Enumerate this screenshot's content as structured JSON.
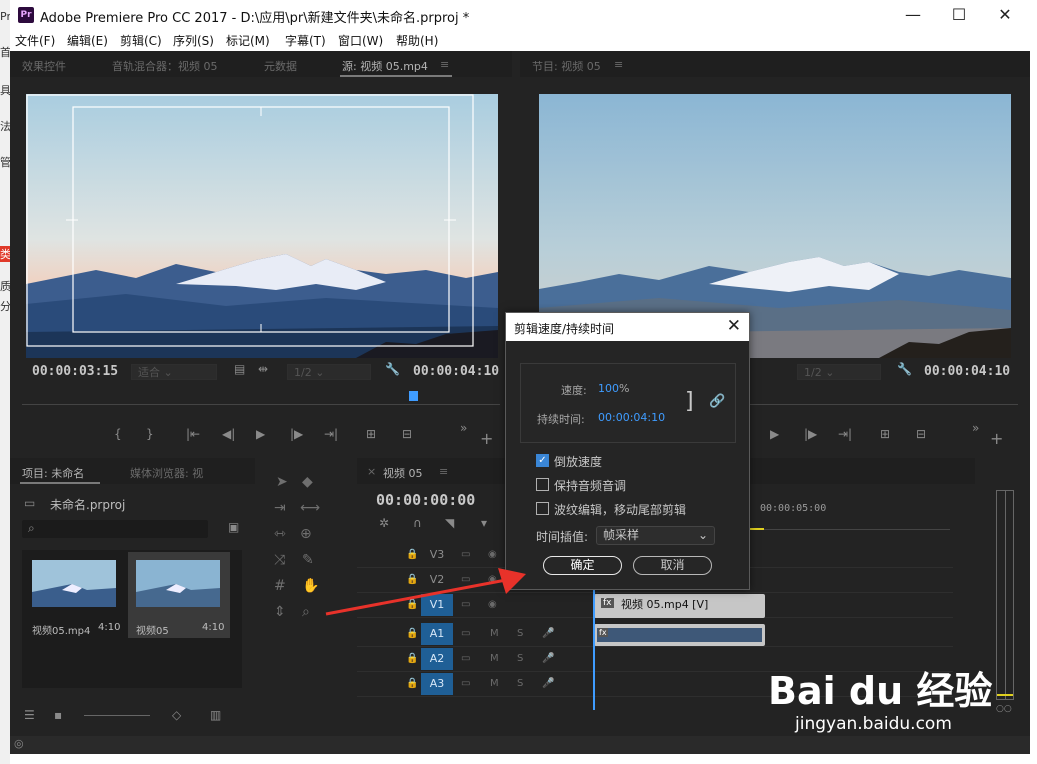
{
  "window": {
    "title": "Adobe Premiere Pro CC 2017 - D:\\应用\\pr\\新建文件夹\\未命名.prproj *",
    "app_icon": "Pr",
    "minimize": "—",
    "maximize": "☐",
    "close": "✕"
  },
  "background_strip": [
    "Pr",
    "首",
    "具",
    "法",
    "管",
    "类",
    "质",
    "分"
  ],
  "menu": [
    "文件(F)",
    "编辑(E)",
    "剪辑(C)",
    "序列(S)",
    "标记(M)",
    "字幕(T)",
    "窗口(W)",
    "帮助(H)"
  ],
  "source_panel": {
    "tabs": [
      "效果控件",
      "音轨混合器：视频 05",
      "元数据",
      "源: 视频 05.mp4"
    ],
    "current_tc": "00:00:03:15",
    "fit": "适合",
    "resolution": "1/2",
    "duration_tc": "00:00:04:10"
  },
  "program_panel": {
    "tab": "节目: 视频 05",
    "resolution": "1/2",
    "duration_tc": "00:00:04:10"
  },
  "project_panel": {
    "tabs": [
      "项目: 未命名",
      "媒体浏览器: 视"
    ],
    "file": "未命名.prproj",
    "items": [
      {
        "name": "视频05.mp4",
        "duration": "4:10"
      },
      {
        "name": "视频05",
        "duration": "4:10"
      }
    ]
  },
  "timeline": {
    "tab": "视频 05",
    "tc": "00:00:00:00",
    "ruler_tc": "00:00:05:00",
    "tracks": [
      "V3",
      "V2",
      "V1",
      "A1",
      "A2",
      "A3"
    ],
    "clip_label": "视频 05.mp4 [V]",
    "audio_flags": [
      "M",
      "S"
    ]
  },
  "dialog": {
    "title": "剪辑速度/持续时间",
    "speed_label": "速度:",
    "speed_value": "100",
    "speed_unit": "%",
    "duration_label": "持续时间:",
    "duration_value": "00:00:04:10",
    "reverse_label": "倒放速度",
    "reverse_checked": true,
    "maintain_pitch_label": "保持音频音调",
    "ripple_label": "波纹编辑，移动尾部剪辑",
    "interp_label": "时间插值:",
    "interp_value": "帧采样",
    "ok": "确定",
    "cancel": "取消"
  },
  "watermark": {
    "logo": "Bai du 经验",
    "url": "jingyan.baidu.com"
  },
  "colors": {
    "accent_blue": "#3f9cff",
    "track_selected": "#1f5f96",
    "arrow_red": "#e8322a"
  }
}
